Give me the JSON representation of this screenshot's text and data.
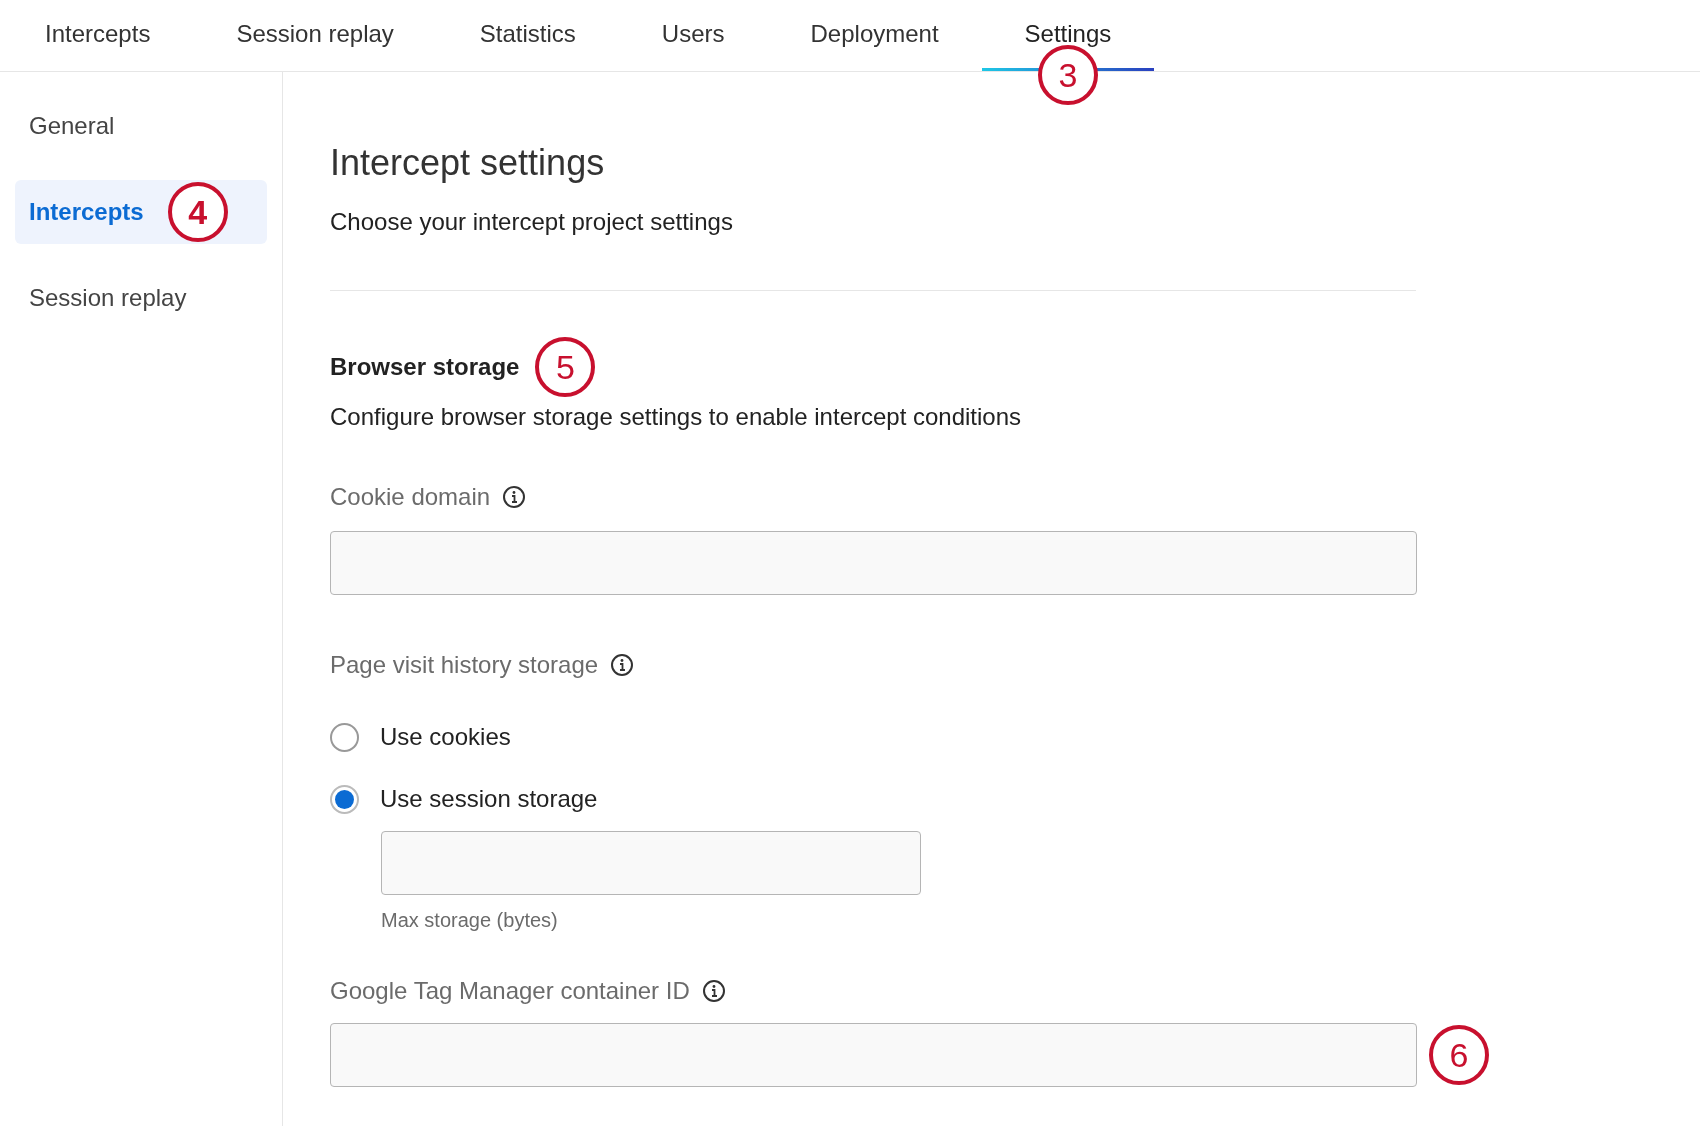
{
  "tabs": [
    {
      "label": "Intercepts",
      "selected": false
    },
    {
      "label": "Session replay",
      "selected": false
    },
    {
      "label": "Statistics",
      "selected": false
    },
    {
      "label": "Users",
      "selected": false
    },
    {
      "label": "Deployment",
      "selected": false
    },
    {
      "label": "Settings",
      "selected": true,
      "callout": "3"
    }
  ],
  "sidebar": {
    "items": [
      {
        "label": "General",
        "selected": false
      },
      {
        "label": "Intercepts",
        "selected": true,
        "callout": "4"
      },
      {
        "label": "Session replay",
        "selected": false
      }
    ]
  },
  "page": {
    "title": "Intercept settings",
    "subtitle": "Choose your intercept project settings"
  },
  "browser_storage": {
    "heading": "Browser storage",
    "callout": "5",
    "description": "Configure browser storage settings to enable intercept conditions",
    "cookie_domain": {
      "label": "Cookie domain"
    },
    "page_visit_history": {
      "label": "Page visit history storage",
      "options": [
        {
          "label": "Use cookies",
          "selected": false
        },
        {
          "label": "Use session storage",
          "selected": true
        }
      ],
      "max_storage": {
        "caption": "Max storage (bytes)"
      }
    },
    "gtm": {
      "label": "Google Tag Manager container ID",
      "callout": "6"
    }
  }
}
